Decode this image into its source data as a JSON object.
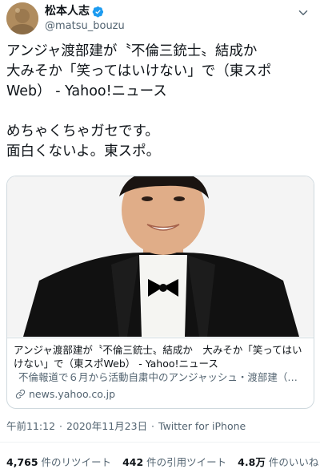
{
  "author": {
    "display_name": "松本人志",
    "handle": "@matsu_bouzu",
    "verified": true
  },
  "icons": {
    "verified": "verified-badge-icon",
    "more": "chevron-down-icon",
    "link": "link-icon"
  },
  "tweet": {
    "text": "アンジャ渡部建が〝不倫三銃士〟結成か\n大みそか「笑ってはいけない」で（東スポ\nWeb） - Yahoo!ニュース\n\nめちゃくちゃガセです。\n面白くないよ。東スポ。"
  },
  "card": {
    "title": "アンジャ渡部建が〝不倫三銃士〟結成か　大みそか「笑ってはいけない」で（東スポWeb） - Yahoo!ニュース",
    "description": "不倫報道で６月から活動自粛中のアンジャッシュ・渡部建（…",
    "domain": "news.yahoo.co.jp"
  },
  "meta": {
    "time": "午前11:12",
    "date": "2020年11月23日",
    "source": "Twitter for iPhone"
  },
  "stats": {
    "retweets_count": "4,765",
    "retweets_label": "件のリツイート",
    "quotes_count": "442",
    "quotes_label": "件の引用ツイート",
    "likes_count": "4.8万",
    "likes_label": "件のいいね"
  },
  "colors": {
    "verified_blue": "#1d9bf0",
    "secondary_text": "#536471",
    "border": "#cfd9de"
  }
}
